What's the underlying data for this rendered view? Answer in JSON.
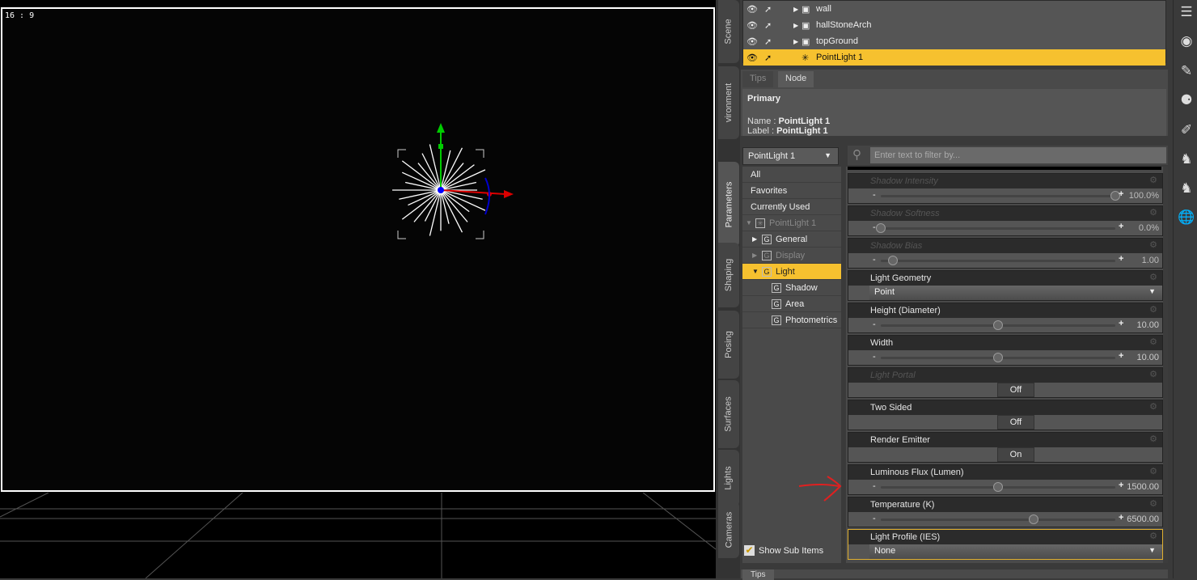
{
  "viewport": {
    "aspect_label": "16 : 9"
  },
  "left_tabs": [
    "Scene",
    "vironment",
    "Parameters",
    "Shaping",
    "Posing",
    "Surfaces",
    "Lights",
    "Cameras"
  ],
  "scene": {
    "items": [
      {
        "label": "wall",
        "icon": "cube-icon",
        "selected": false
      },
      {
        "label": "hallStoneArch",
        "icon": "cube-icon",
        "selected": false
      },
      {
        "label": "topGround",
        "icon": "cube-icon",
        "selected": false
      },
      {
        "label": "PointLight 1",
        "icon": "point-light-icon",
        "selected": true
      }
    ]
  },
  "info": {
    "tabs": [
      "Tips",
      "Node"
    ],
    "active_tab": "Node",
    "heading": "Primary",
    "name_label": "Name :",
    "name_value": "PointLight 1",
    "label_label": "Label :",
    "label_value": "PointLight 1"
  },
  "node_selector": "PointLight 1",
  "tree": [
    {
      "label": "All",
      "indent": 0
    },
    {
      "label": "Favorites",
      "indent": 0
    },
    {
      "label": "Currently Used",
      "indent": 0
    },
    {
      "label": "PointLight 1",
      "indent": 0,
      "dim": true,
      "expander": "▼"
    },
    {
      "label": "General",
      "indent": 1,
      "expander": "▶"
    },
    {
      "label": "Display",
      "indent": 1,
      "dim": true,
      "expander": "▶"
    },
    {
      "label": "Light",
      "indent": 1,
      "expander": "▼",
      "selected": true
    },
    {
      "label": "Shadow",
      "indent": 2
    },
    {
      "label": "Area",
      "indent": 2
    },
    {
      "label": "Photometrics",
      "indent": 2
    }
  ],
  "show_sub_items": {
    "label": "Show Sub Items",
    "checked": true
  },
  "filter": {
    "placeholder": "Enter text to filter by..."
  },
  "params": [
    {
      "label": "Shadow Intensity",
      "type": "slider",
      "value": "100.0%",
      "fraction": 1.0,
      "dim": true
    },
    {
      "label": "Shadow Softness",
      "type": "slider",
      "value": "0.0%",
      "fraction": 0.0,
      "dim": true
    },
    {
      "label": "Shadow Bias",
      "type": "slider",
      "value": "1.00",
      "fraction": 0.05,
      "dim": true
    },
    {
      "label": "Light Geometry",
      "type": "select",
      "value": "Point"
    },
    {
      "label": "Height (Diameter)",
      "type": "slider",
      "value": "10.00",
      "fraction": 0.5
    },
    {
      "label": "Width",
      "type": "slider",
      "value": "10.00",
      "fraction": 0.5
    },
    {
      "label": "Light Portal",
      "type": "toggle",
      "value": "Off",
      "dim": true
    },
    {
      "label": "Two Sided",
      "type": "toggle",
      "value": "Off"
    },
    {
      "label": "Render Emitter",
      "type": "toggle",
      "value": "On"
    },
    {
      "label": "Luminous Flux (Lumen)",
      "type": "slider",
      "value": "1500.00",
      "fraction": 0.5
    },
    {
      "label": "Temperature (K)",
      "type": "slider",
      "value": "6500.00",
      "fraction": 0.65
    },
    {
      "label": "Light Profile (IES)",
      "type": "select",
      "value": "None",
      "highlighted": true
    }
  ],
  "bottom_tab": "Tips",
  "colors": {
    "selection": "#f6c12f",
    "annotation_arrow": "#e02020"
  }
}
